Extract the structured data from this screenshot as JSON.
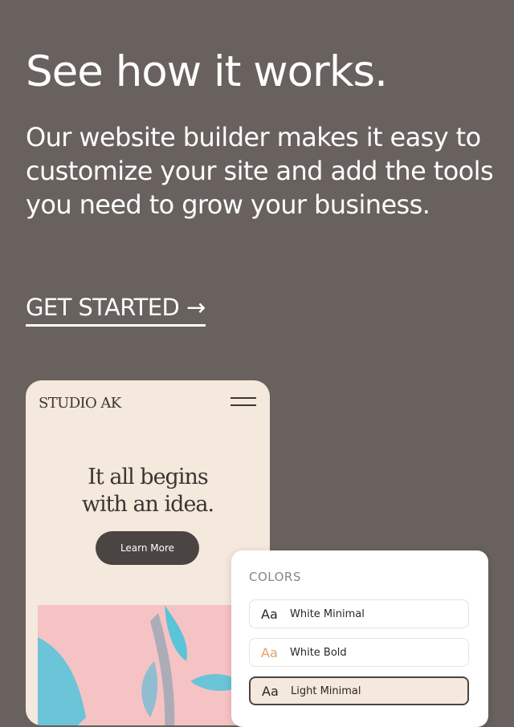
{
  "hero": {
    "headline": "See how it works.",
    "subtext": "Our website builder makes it easy to customize your site and add the tools you need to grow your business.",
    "cta_label": "GET STARTED →"
  },
  "mockup": {
    "brand": "STUDIO AK",
    "hero_title_line1": "It all begins",
    "hero_title_line2": "with an idea.",
    "button_label": "Learn More"
  },
  "colors_panel": {
    "title": "COLORS",
    "options": [
      {
        "aa": "Aa",
        "label": "White Minimal",
        "selected": false
      },
      {
        "aa": "Aa",
        "label": "White Bold",
        "selected": false
      },
      {
        "aa": "Aa",
        "label": "Light Minimal",
        "selected": true
      }
    ]
  },
  "colors": {
    "page_background": "#68615e",
    "phone_background": "#f5e8dc",
    "accent_pink": "#f6c3c5",
    "accent_teal": "#5cc4d8",
    "button_dark": "#4a4443",
    "bold_aa": "#e0a066"
  },
  "icons": {
    "menu": "hamburger-menu-icon",
    "arrow": "arrow-right-icon"
  }
}
